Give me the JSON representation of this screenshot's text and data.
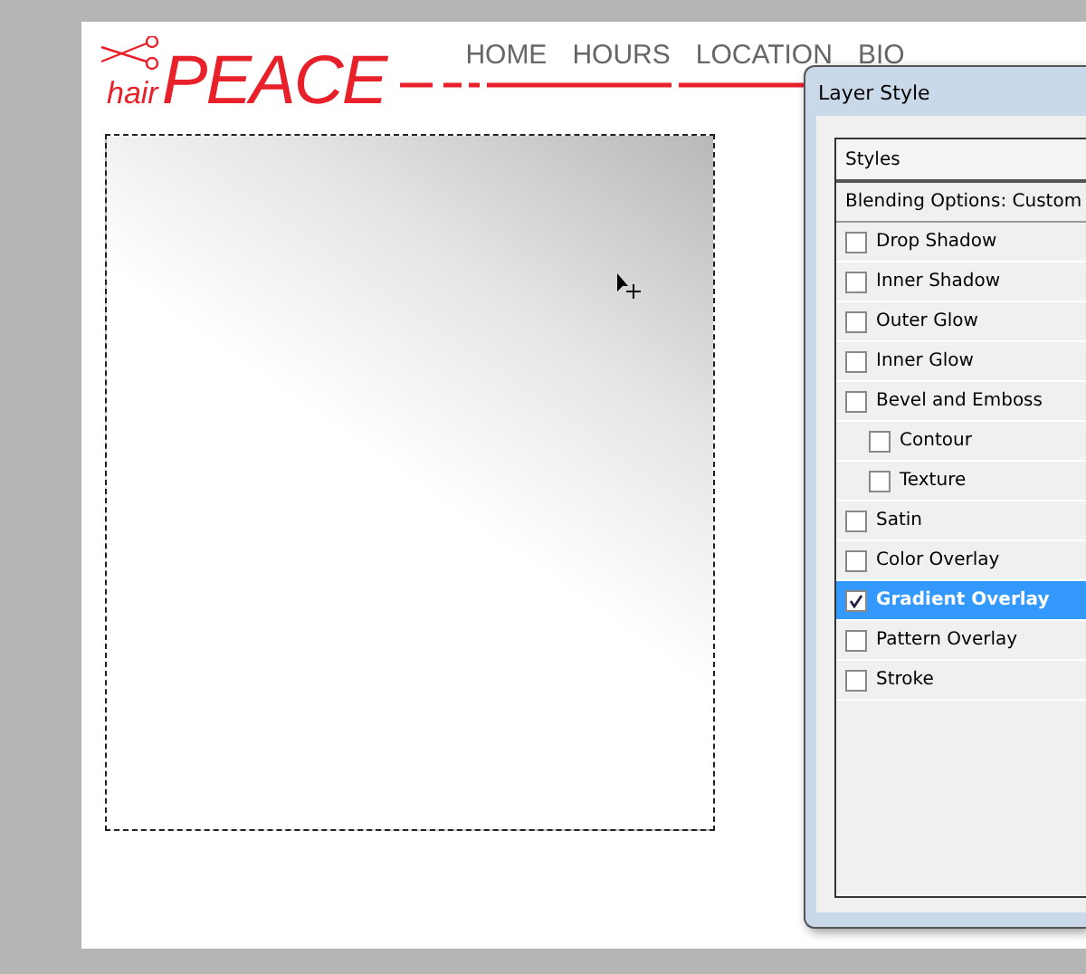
{
  "website": {
    "logo": {
      "small": "hair",
      "large": "PEACE"
    },
    "nav": [
      "HOME",
      "HOURS",
      "LOCATION",
      "BIO"
    ]
  },
  "dialog": {
    "title": "Layer Style",
    "styles_header": "Styles",
    "blending_options": "Blending Options: Custom",
    "effects": [
      {
        "label": "Drop Shadow",
        "checked": false,
        "selected": false
      },
      {
        "label": "Inner Shadow",
        "checked": false,
        "selected": false
      },
      {
        "label": "Outer Glow",
        "checked": false,
        "selected": false
      },
      {
        "label": "Inner Glow",
        "checked": false,
        "selected": false
      },
      {
        "label": "Bevel and Emboss",
        "checked": false,
        "selected": false,
        "children": [
          {
            "label": "Contour",
            "checked": false,
            "selected": false
          },
          {
            "label": "Texture",
            "checked": false,
            "selected": false
          }
        ]
      },
      {
        "label": "Satin",
        "checked": false,
        "selected": false
      },
      {
        "label": "Color Overlay",
        "checked": false,
        "selected": false
      },
      {
        "label": "Gradient Overlay",
        "checked": true,
        "selected": true
      },
      {
        "label": "Pattern Overlay",
        "checked": false,
        "selected": false
      },
      {
        "label": "Stroke",
        "checked": false,
        "selected": false
      }
    ]
  }
}
